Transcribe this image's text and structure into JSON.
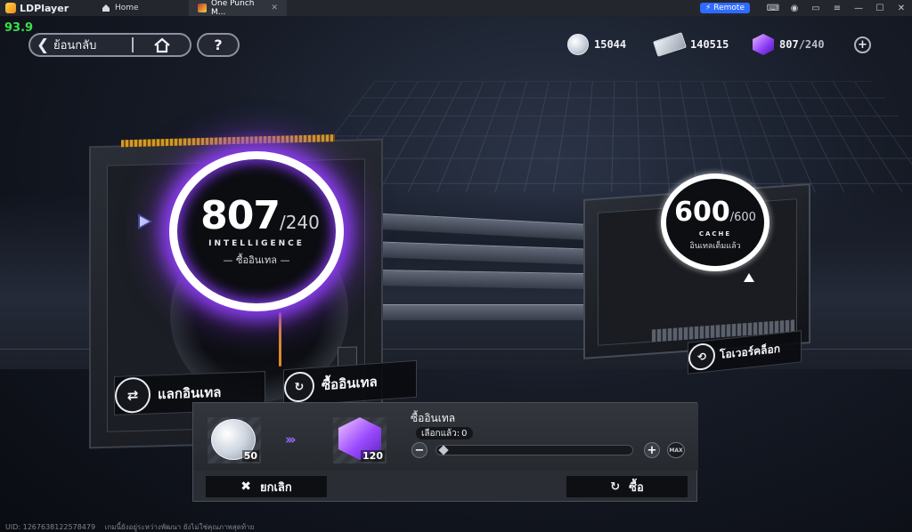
{
  "titlebar": {
    "app_name": "LDPlayer",
    "tabs": [
      {
        "label": "Home"
      },
      {
        "label": "One Punch M..."
      }
    ],
    "remote_label": "Remote"
  },
  "fps": "93.9",
  "nav": {
    "back_label": "ย้อนกลับ",
    "help_label": "?"
  },
  "currencies": [
    {
      "icon": "silver-coin-icon",
      "value": "15044"
    },
    {
      "icon": "ticket-icon",
      "value": "140515"
    },
    {
      "icon": "intel-cube-icon",
      "value": "807",
      "max": "/240"
    }
  ],
  "intelligence": {
    "current": "807",
    "max": "/240",
    "caption": "INTELLIGENCE",
    "sub": "— ซื้ออินเทล —"
  },
  "cache": {
    "current": "600",
    "max": "/600",
    "caption": "CACHE",
    "sub": "อินเทลเต็มแล้ว"
  },
  "actions": {
    "exchange": "แลกอินเทล",
    "buy": "ซื้ออินเทล",
    "overclock": "โอเวอร์คล็อก"
  },
  "purchase": {
    "title": "ซื้ออินเทล",
    "selected_label": "เลือกแล้ว:",
    "selected_count": "0",
    "cost_amount": "50",
    "reward_amount": "120",
    "max_label": "MAX",
    "slider_fraction": 0,
    "cancel_label": "ยกเลิก",
    "buy_label": "ซื้อ"
  },
  "footer": {
    "uid": "UID: 1267638122578479",
    "notice": "เกมนี้ยังอยู่ระหว่างพัฒนา ยังไม่ใช่คุณภาพสุดท้าย"
  },
  "colors": {
    "accent_purple": "#8a3df0",
    "fps_green": "#39e04a",
    "remote_blue": "#2f6bff"
  }
}
